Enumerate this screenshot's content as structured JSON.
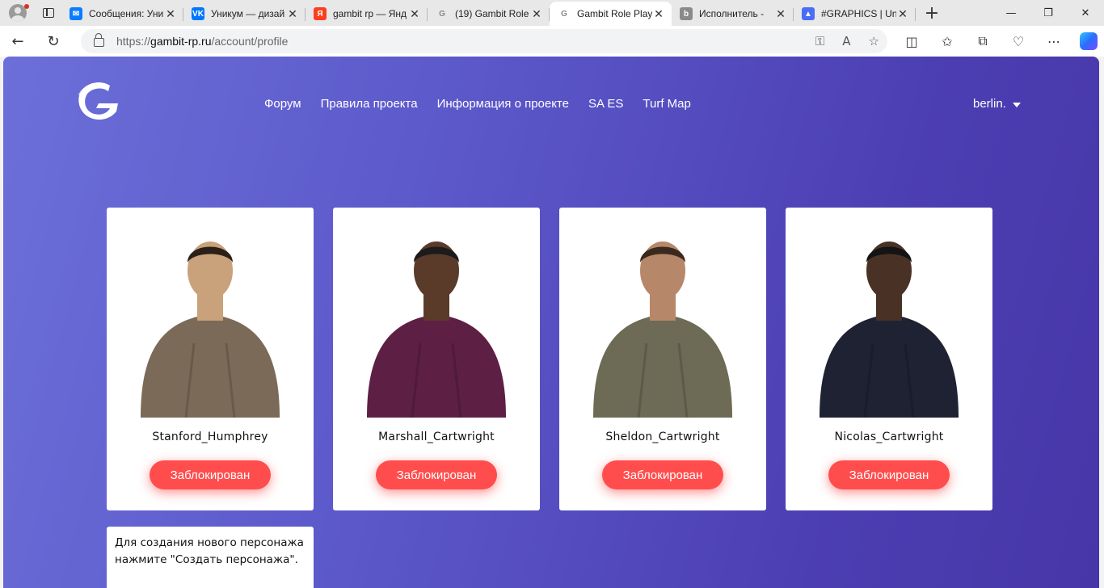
{
  "browser": {
    "tabs": [
      {
        "title": "Сообщения: Уни",
        "favicon": "messages-icon",
        "color": "#0a7cff",
        "glyph": "✉"
      },
      {
        "title": "Уникум — дизай",
        "favicon": "vk-icon",
        "color": "#0077ff",
        "glyph": "VK"
      },
      {
        "title": "gambit rp — Янд",
        "favicon": "yandex-icon",
        "color": "#fc3f1d",
        "glyph": "Я"
      },
      {
        "title": "(19) Gambit Role",
        "favicon": "gambit-icon",
        "color": "#cfcfcf",
        "glyph": "G"
      },
      {
        "title": "Gambit Role Play",
        "favicon": "gambit-icon",
        "color": "#cfcfcf",
        "glyph": "G",
        "active": true
      },
      {
        "title": "Исполнитель - ",
        "favicon": "behance-icon",
        "color": "#8a8a8a",
        "glyph": "b"
      },
      {
        "title": "#GRAPHICS | Uniq",
        "favicon": "graphics-icon",
        "color": "#4a6cf7",
        "glyph": "▲"
      }
    ],
    "url_prefix": "https://",
    "url_host": "gambit-rp.ru",
    "url_path": "/account/profile"
  },
  "site": {
    "nav": [
      "Форум",
      "Правила проекта",
      "Информация о проекте",
      "SA ES",
      "Turf Map"
    ],
    "username": "berlin."
  },
  "characters": [
    {
      "name": "Stanford_Humphrey",
      "status": "Заблокирован",
      "skin": "#c9a17a",
      "shirt": "#7b6a58",
      "hair": "#2a2018"
    },
    {
      "name": "Marshall_Cartwright",
      "status": "Заблокирован",
      "skin": "#5a3b2a",
      "shirt": "#5e1f45",
      "hair": "#1b1b1b"
    },
    {
      "name": "Sheldon_Cartwright",
      "status": "Заблокирован",
      "skin": "#b7876a",
      "shirt": "#6d6a55",
      "hair": "#3a2a1e"
    },
    {
      "name": "Nicolas_Cartwright",
      "status": "Заблокирован",
      "skin": "#4a3126",
      "shirt": "#1e2233",
      "hair": "#141414"
    }
  ],
  "new_character_hint": "Для создания нового персонажа нажмите \"Создать персонажа\"."
}
